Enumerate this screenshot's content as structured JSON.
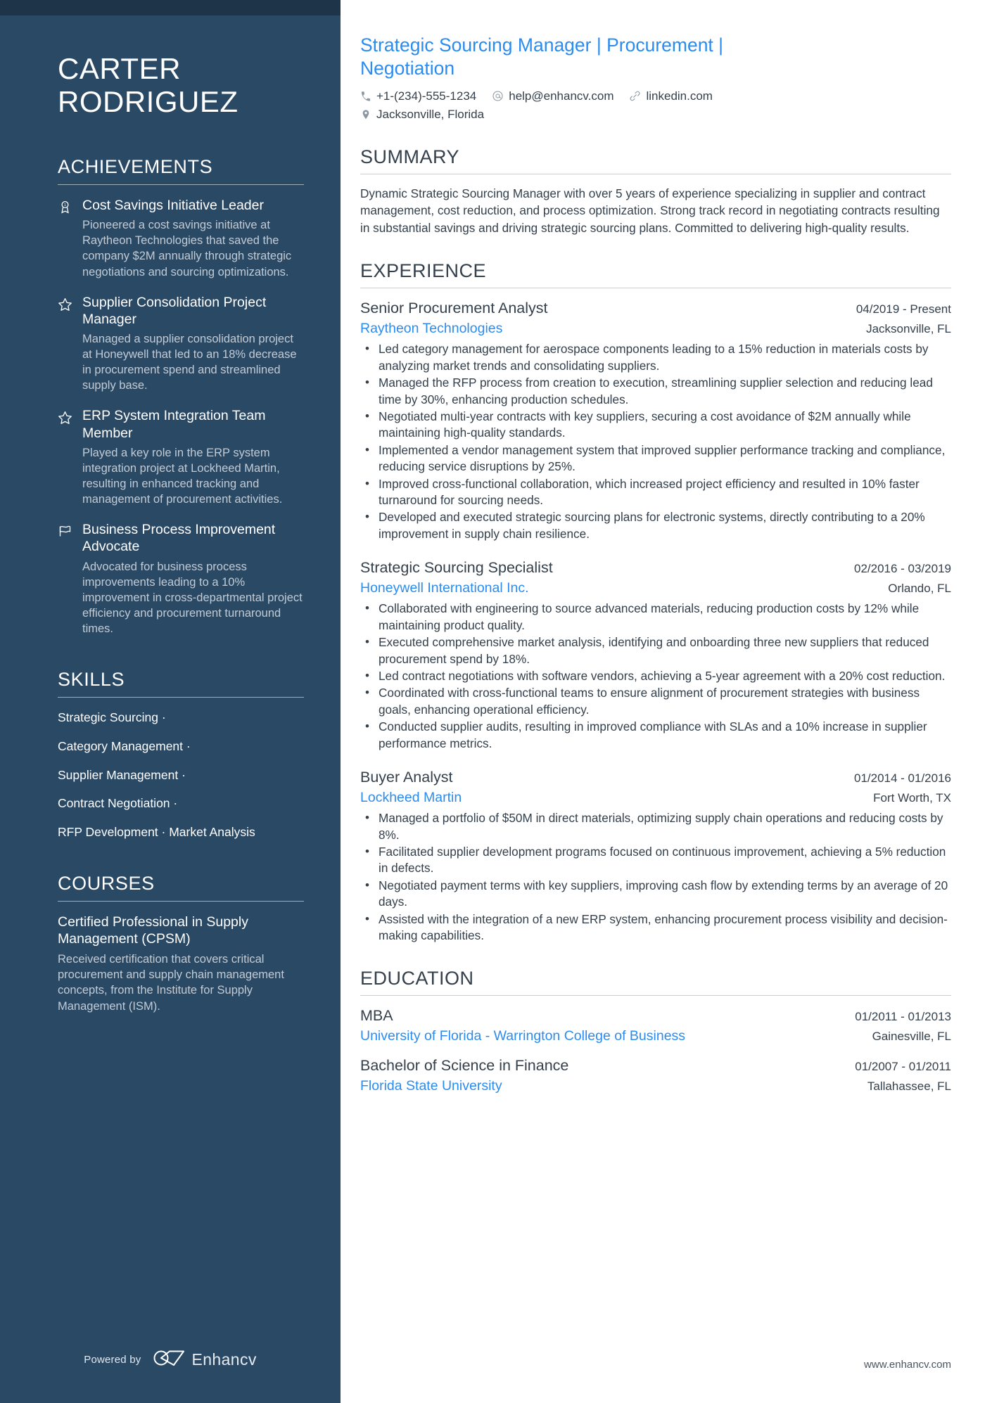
{
  "sidebar": {
    "name_line1": "CARTER",
    "name_line2": "RODRIGUEZ",
    "achievements": {
      "heading": "ACHIEVEMENTS",
      "items": [
        {
          "icon": "award-ribbon-icon",
          "title": "Cost Savings Initiative Leader",
          "description": "Pioneered a cost savings initiative at Raytheon Technologies that saved the company $2M annually through strategic negotiations and sourcing optimizations."
        },
        {
          "icon": "star-icon",
          "title": "Supplier Consolidation Project Manager",
          "description": "Managed a supplier consolidation project at Honeywell that led to an 18% decrease in procurement spend and streamlined supply base."
        },
        {
          "icon": "star-icon",
          "title": "ERP System Integration Team Member",
          "description": "Played a key role in the ERP system integration project at Lockheed Martin, resulting in enhanced tracking and management of procurement activities."
        },
        {
          "icon": "flag-icon",
          "title": "Business Process Improvement Advocate",
          "description": "Advocated for business process improvements leading to a 10% improvement in cross-departmental project efficiency and procurement turnaround times."
        }
      ]
    },
    "skills": {
      "heading": "SKILLS",
      "lines": [
        "Strategic Sourcing ·",
        "Category Management ·",
        "Supplier Management ·",
        "Contract Negotiation ·",
        "RFP Development · Market Analysis"
      ]
    },
    "courses": {
      "heading": "COURSES",
      "items": [
        {
          "title": "Certified Professional in Supply Management (CPSM)",
          "description": "Received certification that covers critical procurement and supply chain management concepts, from the Institute for Supply Management (ISM)."
        }
      ]
    },
    "footer": {
      "powered_by": "Powered by",
      "brand": "Enhancv",
      "logo_icon": "enhancv-logo-icon"
    }
  },
  "main": {
    "headline": "Strategic Sourcing Manager | Procurement | Negotiation",
    "contact": [
      {
        "icon": "phone-icon",
        "value": "+1-(234)-555-1234"
      },
      {
        "icon": "email-at-icon",
        "value": "help@enhancv.com"
      },
      {
        "icon": "link-icon",
        "value": "linkedin.com"
      }
    ],
    "contact_second_row": [
      {
        "icon": "location-pin-icon",
        "value": "Jacksonville, Florida"
      }
    ],
    "summary": {
      "heading": "SUMMARY",
      "text": "Dynamic Strategic Sourcing Manager with over 5 years of experience specializing in supplier and contract management, cost reduction, and process optimization. Strong track record in negotiating contracts resulting in substantial savings and driving strategic sourcing plans. Committed to delivering high-quality results."
    },
    "experience": {
      "heading": "EXPERIENCE",
      "entries": [
        {
          "role": "Senior Procurement Analyst",
          "date": "04/2019 - Present",
          "company": "Raytheon Technologies",
          "location": "Jacksonville, FL",
          "bullets": [
            "Led category management for aerospace components leading to a 15% reduction in materials costs by analyzing market trends and consolidating suppliers.",
            "Managed the RFP process from creation to execution, streamlining supplier selection and reducing lead time by 30%, enhancing production schedules.",
            "Negotiated multi-year contracts with key suppliers, securing a cost avoidance of $2M annually while maintaining high-quality standards.",
            "Implemented a vendor management system that improved supplier performance tracking and compliance, reducing service disruptions by 25%.",
            "Improved cross-functional collaboration, which increased project efficiency and resulted in 10% faster turnaround for sourcing needs.",
            "Developed and executed strategic sourcing plans for electronic systems, directly contributing to a 20% improvement in supply chain resilience."
          ]
        },
        {
          "role": "Strategic Sourcing Specialist",
          "date": "02/2016 - 03/2019",
          "company": "Honeywell International Inc.",
          "location": "Orlando, FL",
          "bullets": [
            "Collaborated with engineering to source advanced materials, reducing production costs by 12% while maintaining product quality.",
            "Executed comprehensive market analysis, identifying and onboarding three new suppliers that reduced procurement spend by 18%.",
            "Led contract negotiations with software vendors, achieving a 5-year agreement with a 20% cost reduction.",
            "Coordinated with cross-functional teams to ensure alignment of procurement strategies with business goals, enhancing operational efficiency.",
            "Conducted supplier audits, resulting in improved compliance with SLAs and a 10% increase in supplier performance metrics."
          ]
        },
        {
          "role": "Buyer Analyst",
          "date": "01/2014 - 01/2016",
          "company": "Lockheed Martin",
          "location": "Fort Worth, TX",
          "bullets": [
            "Managed a portfolio of $50M in direct materials, optimizing supply chain operations and reducing costs by 8%.",
            "Facilitated supplier development programs focused on continuous improvement, achieving a 5% reduction in defects.",
            "Negotiated payment terms with key suppliers, improving cash flow by extending terms by an average of 20 days.",
            "Assisted with the integration of a new ERP system, enhancing procurement process visibility and decision-making capabilities."
          ]
        }
      ]
    },
    "education": {
      "heading": "EDUCATION",
      "entries": [
        {
          "degree": "MBA",
          "date": "01/2011 - 01/2013",
          "school": "University of Florida - Warrington College of Business",
          "location": "Gainesville, FL"
        },
        {
          "degree": "Bachelor of Science in Finance",
          "date": "01/2007 - 01/2011",
          "school": "Florida State University",
          "location": "Tallahassee, FL"
        }
      ]
    },
    "footer_url": "www.enhancv.com"
  },
  "colors": {
    "sidebar_bg": "#2a4965",
    "sidebar_topbar": "#1d3449",
    "accent_blue": "#2b8cf0",
    "body_text": "#34404c",
    "muted_text": "#c2ccd6"
  }
}
